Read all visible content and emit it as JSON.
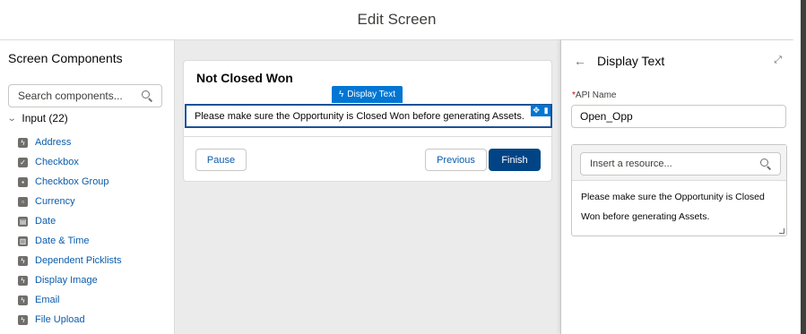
{
  "header": {
    "title": "Edit Screen"
  },
  "left": {
    "title": "Screen Components",
    "search_placeholder": "Search components...",
    "group_label": "Input (22)",
    "items": [
      {
        "label": "Address",
        "icon": "bolt-icon"
      },
      {
        "label": "Checkbox",
        "icon": "checkbox-icon"
      },
      {
        "label": "Checkbox Group",
        "icon": "checkbox-group-icon"
      },
      {
        "label": "Currency",
        "icon": "currency-icon"
      },
      {
        "label": "Date",
        "icon": "date-icon"
      },
      {
        "label": "Date & Time",
        "icon": "datetime-icon"
      },
      {
        "label": "Dependent Picklists",
        "icon": "bolt-icon"
      },
      {
        "label": "Display Image",
        "icon": "bolt-icon"
      },
      {
        "label": "Email",
        "icon": "bolt-icon"
      },
      {
        "label": "File Upload",
        "icon": "bolt-icon"
      }
    ]
  },
  "canvas": {
    "card_title": "Not Closed Won",
    "tag_label": "Display Text",
    "text": "Please make sure the Opportunity is Closed Won before generating Assets.",
    "pause_label": "Pause",
    "previous_label": "Previous",
    "finish_label": "Finish"
  },
  "props": {
    "title": "Display Text",
    "api_label": "API Name",
    "api_value": "Open_Opp",
    "resource_placeholder": "Insert a resource...",
    "editor_text": "Please make sure the Opportunity is Closed Won before generating Assets."
  },
  "colors": {
    "brand": "#0176d3",
    "finish": "#014486",
    "link": "#0b5cab"
  }
}
